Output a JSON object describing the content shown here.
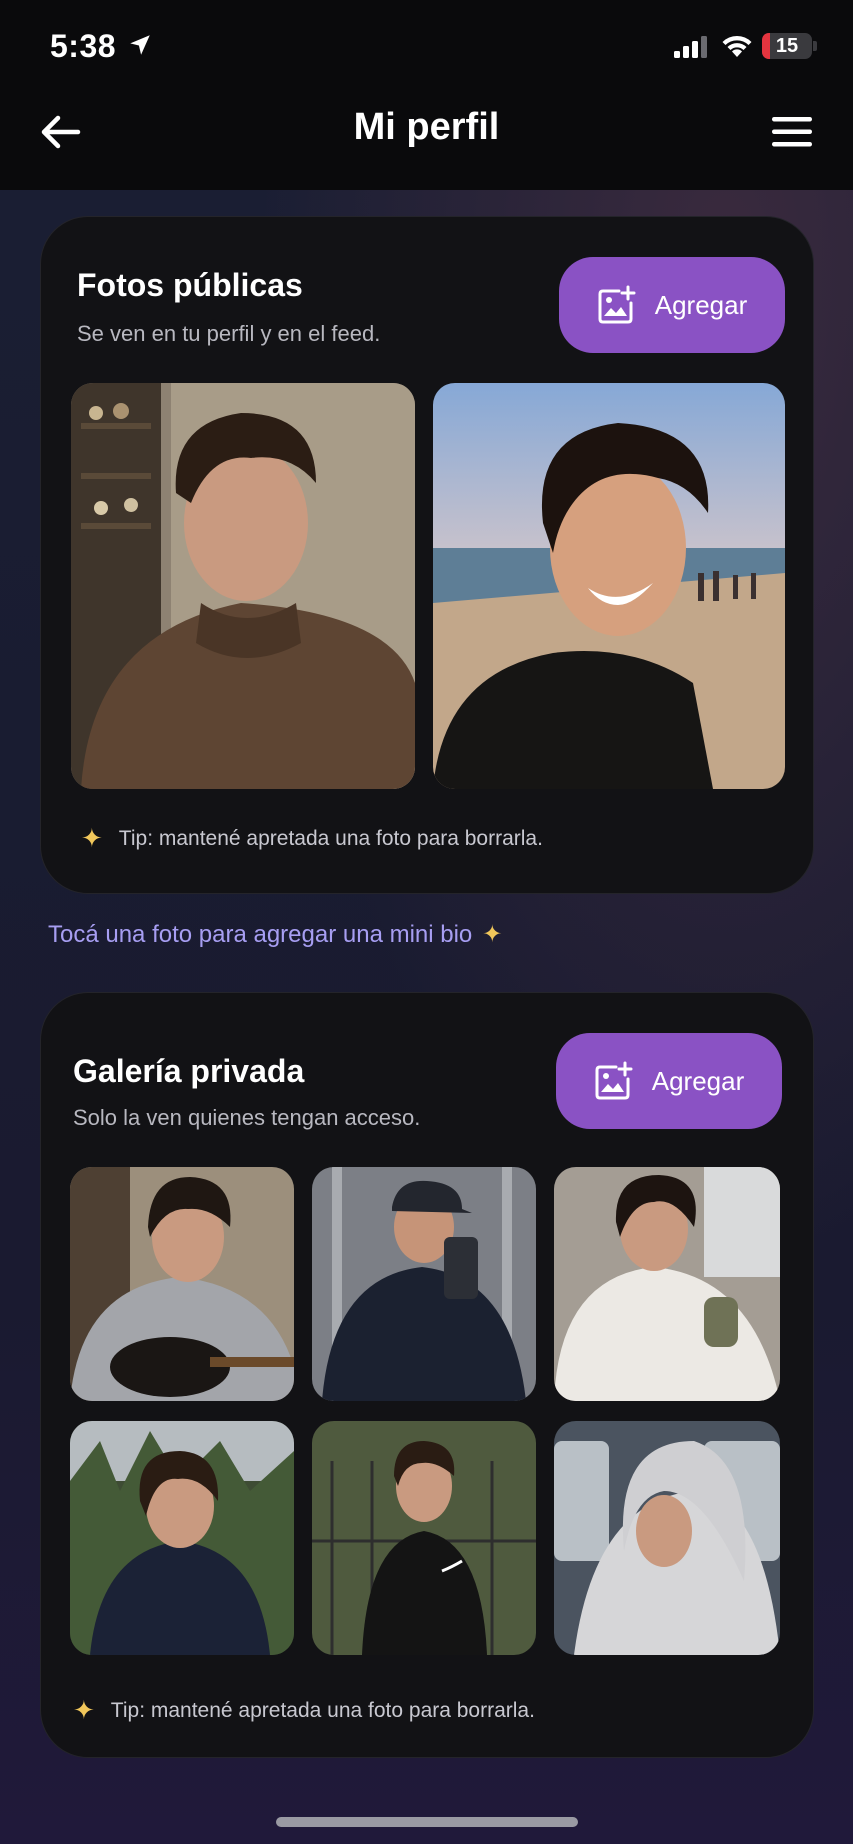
{
  "status_bar": {
    "time": "5:38",
    "battery": "15",
    "battery_level": 0.15
  },
  "header": {
    "title": "Mi perfil"
  },
  "public_section": {
    "title": "Fotos públicas",
    "subtitle": "Se ven en tu perfil y en el feed.",
    "add_label": "Agregar",
    "tip": "Tip: mantené apretada una foto para borrarla."
  },
  "hint": "Tocá una foto para agregar una mini bio",
  "private_section": {
    "title": "Galería privada",
    "subtitle": "Solo la ven quienes tengan acceso.",
    "add_label": "Agregar",
    "tip": "Tip: mantené apretada una foto para borrarla."
  },
  "colors": {
    "accent": "#8a52c4",
    "hint": "#a79ef2",
    "sparkle": "#f1c75b",
    "card": "#121215"
  }
}
